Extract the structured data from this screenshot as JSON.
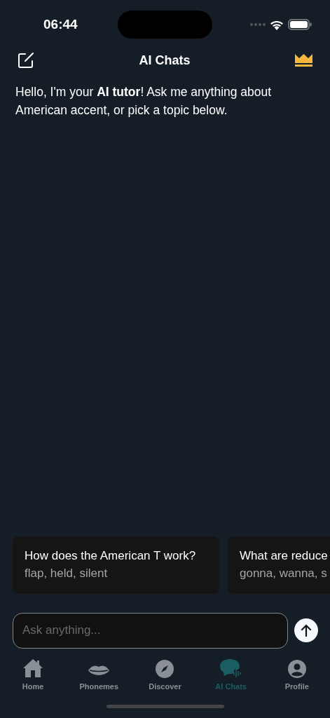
{
  "status_bar": {
    "time": "06:44"
  },
  "header": {
    "title": "AI Chats"
  },
  "message": "Hello, I'm your **AI tutor**! Ask me anything about American accent, or pick a topic below.",
  "topics": [
    {
      "title": "How does the American T work?",
      "subtitle": "flap, held, silent"
    },
    {
      "title": "What are reduce",
      "subtitle": "gonna, wanna, s"
    }
  ],
  "input": {
    "placeholder": "Ask anything..."
  },
  "tabs": [
    {
      "label": "Home",
      "kind": "home",
      "selected": false
    },
    {
      "label": "Phonemes",
      "kind": "lips",
      "selected": false
    },
    {
      "label": "Discover",
      "kind": "compass",
      "selected": false
    },
    {
      "label": "AI Chats",
      "kind": "chat",
      "selected": true
    },
    {
      "label": "Profile",
      "kind": "profile",
      "selected": false
    }
  ]
}
